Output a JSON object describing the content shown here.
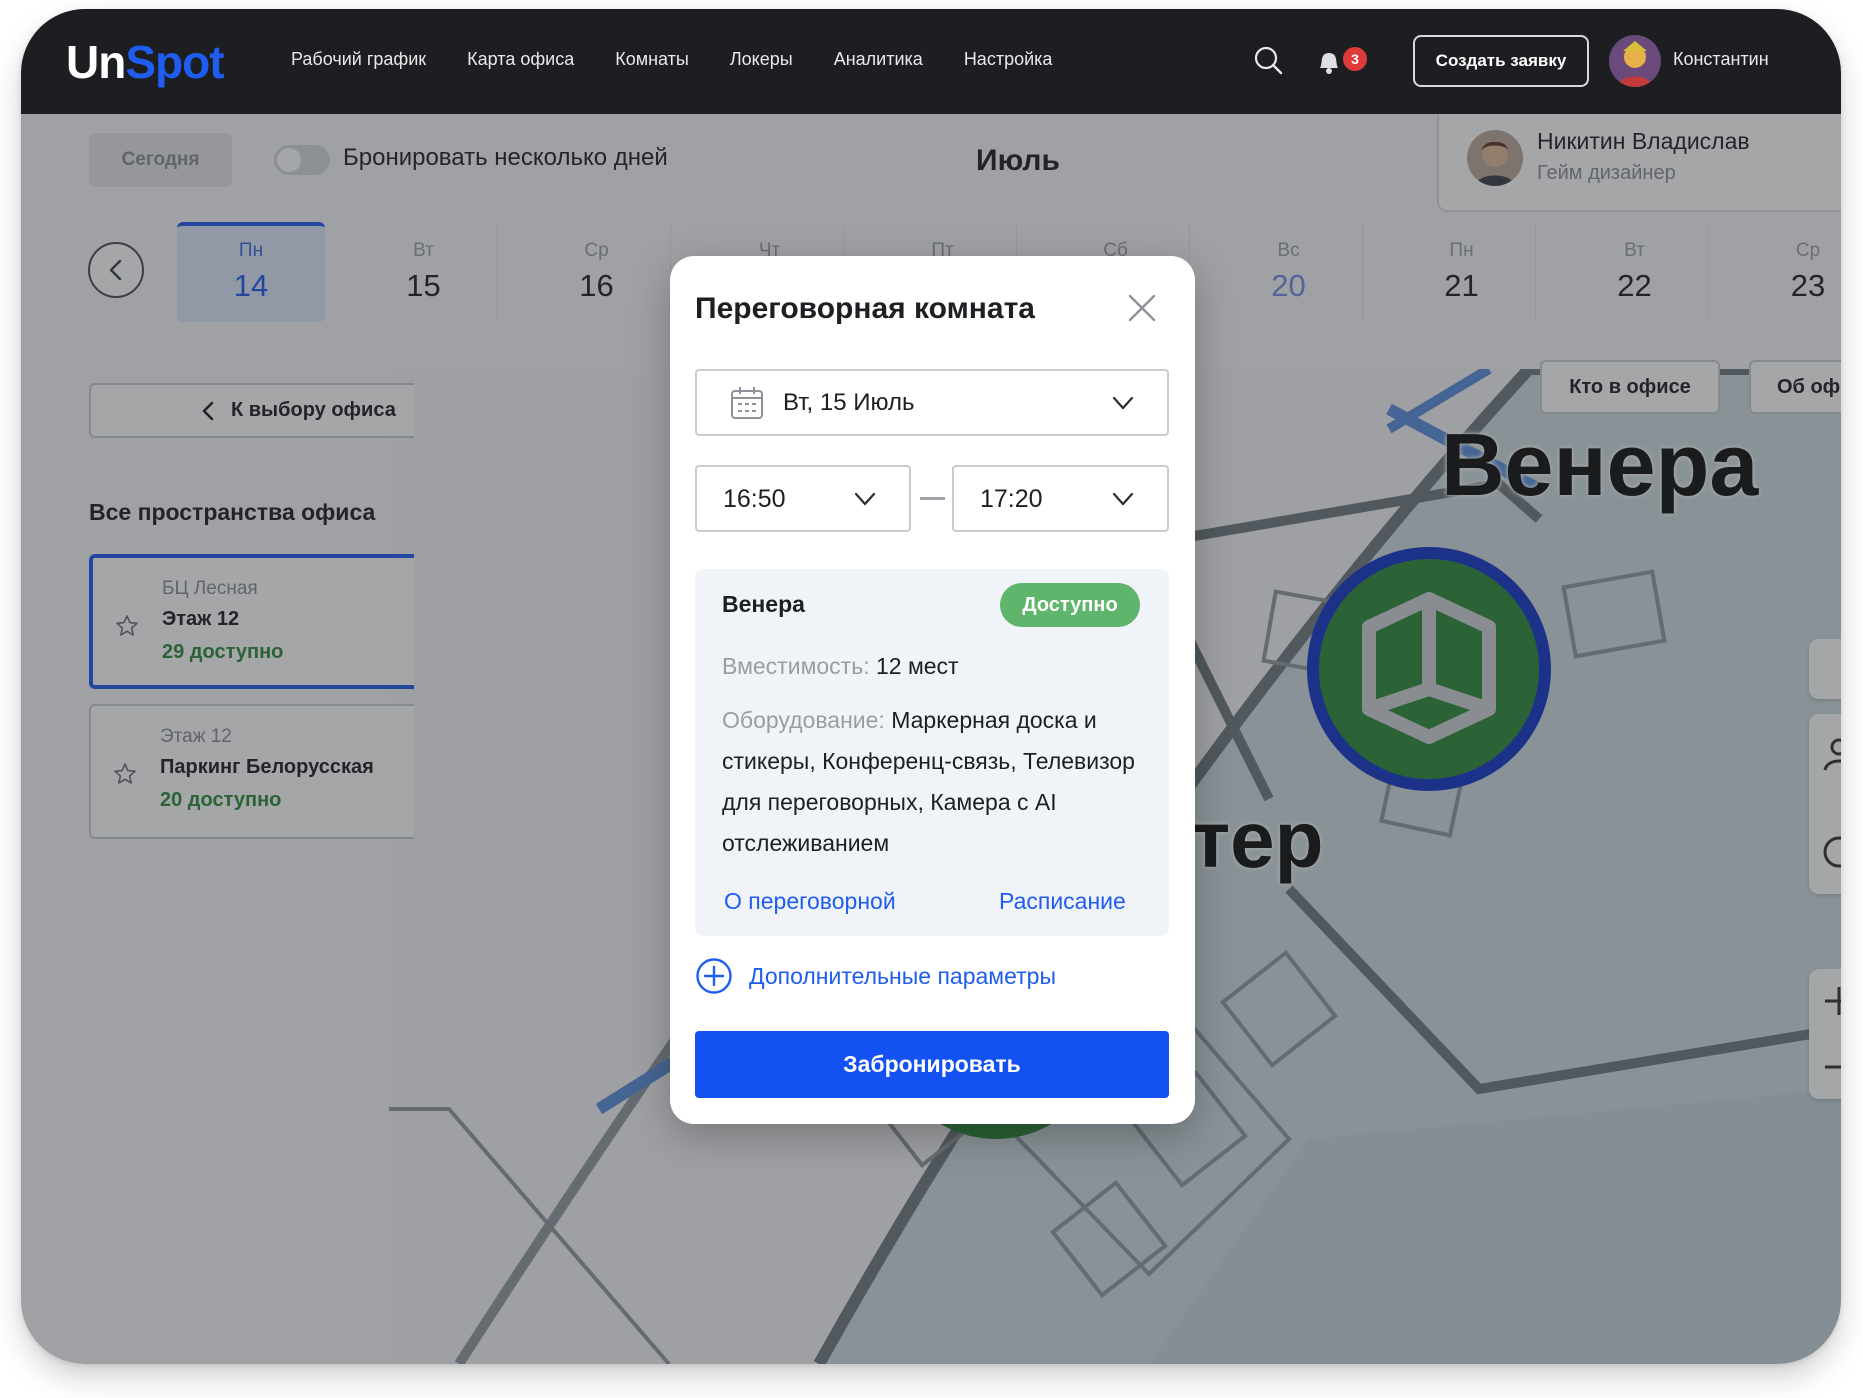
{
  "app": {
    "logo_part1": "Un",
    "logo_part2": "Spot",
    "nav": [
      "Рабочий график",
      "Карта офиса",
      "Комнаты",
      "Локеры",
      "Аналитика",
      "Настройка"
    ],
    "notifications_count": "3",
    "create_request_label": "Создать заявку",
    "user_name": "Константин"
  },
  "toolbar": {
    "today_label": "Сегодня",
    "multi_day_label": "Бронировать несколько дней",
    "multi_day_enabled": false,
    "month": "Июль"
  },
  "person": {
    "name": "Никитин Владислав",
    "role": "Гейм дизайнер"
  },
  "calendar": {
    "days": [
      {
        "name": "Пн",
        "date": "14",
        "selected": true
      },
      {
        "name": "Вт",
        "date": "15"
      },
      {
        "name": "Ср",
        "date": "16"
      },
      {
        "name": "Чт",
        "date": ""
      },
      {
        "name": "Пт",
        "date": ""
      },
      {
        "name": "Сб",
        "date": ""
      },
      {
        "name": "Вс",
        "date": "20",
        "weekend": true
      },
      {
        "name": "Пн",
        "date": "21"
      },
      {
        "name": "Вт",
        "date": "22"
      },
      {
        "name": "Ср",
        "date": "23"
      }
    ]
  },
  "sidebar": {
    "back_label": "К выбору офиса",
    "spaces_title": "Все пространства офиса",
    "offices": [
      {
        "line1": "БЦ Лесная",
        "line2": "Этаж 12",
        "available": "29 доступно",
        "active": true
      },
      {
        "line1": "Этаж 12",
        "line2": "Паркинг Белорусская",
        "available": "20 доступно"
      }
    ]
  },
  "map": {
    "who_in_office_label": "Кто в офисе",
    "about_office_label": "Об офисе",
    "room_label_main": "Венера",
    "room_label_partial": "тер",
    "colors": {
      "room_available": "#2e8b3c",
      "room_selected_ring": "#1438c8",
      "floor": "#c9d6da"
    }
  },
  "modal": {
    "title": "Переговорная комната",
    "date_value": "Вт, 15 Июль",
    "time_from": "16:50",
    "time_to": "17:20",
    "room": {
      "name": "Венера",
      "status": "Доступно",
      "capacity_label": "Вместимость:",
      "capacity_value": "12 мест",
      "equipment_label": "Оборудование:",
      "equipment_value": "Маркерная доска и стикеры, Конференц-связь, Телевизор для переговорных, Камера с AI отслеживанием",
      "about_link": "О переговорной",
      "schedule_link": "Расписание"
    },
    "extra_params_label": "Дополнительные параметры",
    "book_button": "Забронировать"
  },
  "colors": {
    "accent": "#1f5cf0",
    "status_available": "#5fb56b",
    "topbar_bg": "#1c1e22",
    "badge": "#e03b3b"
  }
}
